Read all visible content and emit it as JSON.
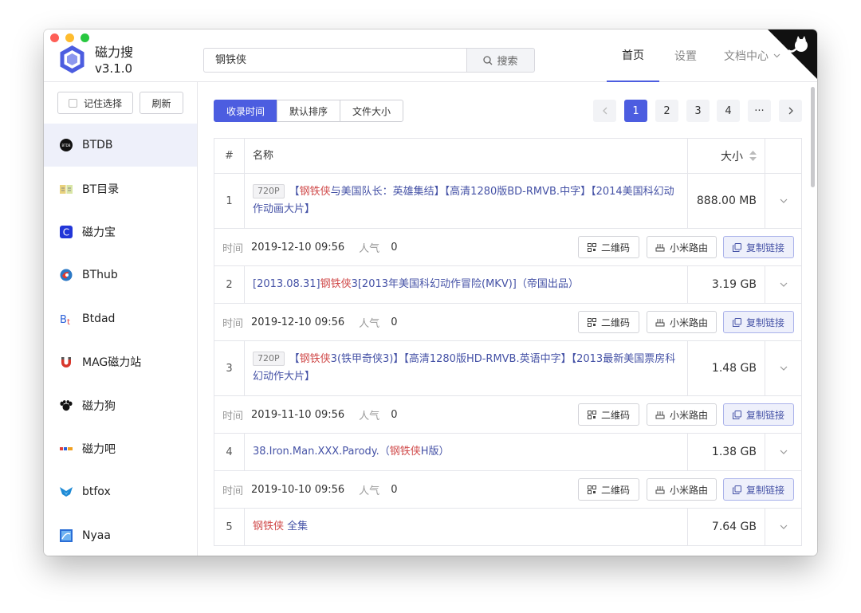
{
  "app": {
    "name": "磁力搜",
    "version": "v3.1.0"
  },
  "search": {
    "value": "钢铁侠",
    "button": "搜索"
  },
  "nav": {
    "home": "首页",
    "settings": "设置",
    "docs": "文档中心"
  },
  "sidebar": {
    "remember": "记住选择",
    "refresh": "刷新",
    "sites": [
      "BTDB",
      "BT目录",
      "磁力宝",
      "BThub",
      "Btdad",
      "MAG磁力站",
      "磁力狗",
      "磁力吧",
      "btfox",
      "Nyaa"
    ]
  },
  "sort": {
    "by_time": "收录时间",
    "default": "默认排序",
    "by_size": "文件大小"
  },
  "pagination": {
    "pages": [
      "1",
      "2",
      "3",
      "4"
    ],
    "current": "1",
    "more": "···"
  },
  "table": {
    "head": {
      "index": "#",
      "name": "名称",
      "size": "大小"
    },
    "labels": {
      "time": "时间",
      "popularity": "人气",
      "qr": "二维码",
      "mi_router": "小米路由",
      "copy_link": "复制链接"
    },
    "rows": [
      {
        "index": "1",
        "badge": "720P",
        "pre": "【",
        "hl": "钢铁侠",
        "post": "与美国队长：英雄集结】【高清1280版BD-RMVB.中字】【2014美国科幻动作动画大片】",
        "size": "888.00 MB",
        "time": "2019-12-10 09:56",
        "popularity": "0"
      },
      {
        "index": "2",
        "badge": "",
        "pre": "[2013.08.31]",
        "hl": "钢铁侠",
        "post": "3[2013年美国科幻动作冒险(MKV)]（帝国出品）",
        "size": "3.19 GB",
        "time": "2019-12-10 09:56",
        "popularity": "0"
      },
      {
        "index": "3",
        "badge": "720P",
        "pre": "【",
        "hl": "钢铁侠",
        "post": "3(铁甲奇侠3)】【高清1280版HD-RMVB.英语中字】【2013最新美国票房科幻动作大片】",
        "size": "1.48 GB",
        "time": "2019-11-10 09:56",
        "popularity": "0"
      },
      {
        "index": "4",
        "badge": "",
        "pre": "38.Iron.Man.XXX.Parody.（",
        "hl": "钢铁侠",
        "post": "H版）",
        "size": "1.38 GB",
        "time": "2019-10-10 09:56",
        "popularity": "0"
      },
      {
        "index": "5",
        "badge": "",
        "pre": "",
        "hl": "钢铁侠",
        "post": " 全集",
        "size": "7.64 GB",
        "time": "",
        "popularity": ""
      }
    ]
  },
  "colors": {
    "accent": "#4c5de0",
    "highlight": "#d04b4b",
    "link": "#4552a6"
  }
}
